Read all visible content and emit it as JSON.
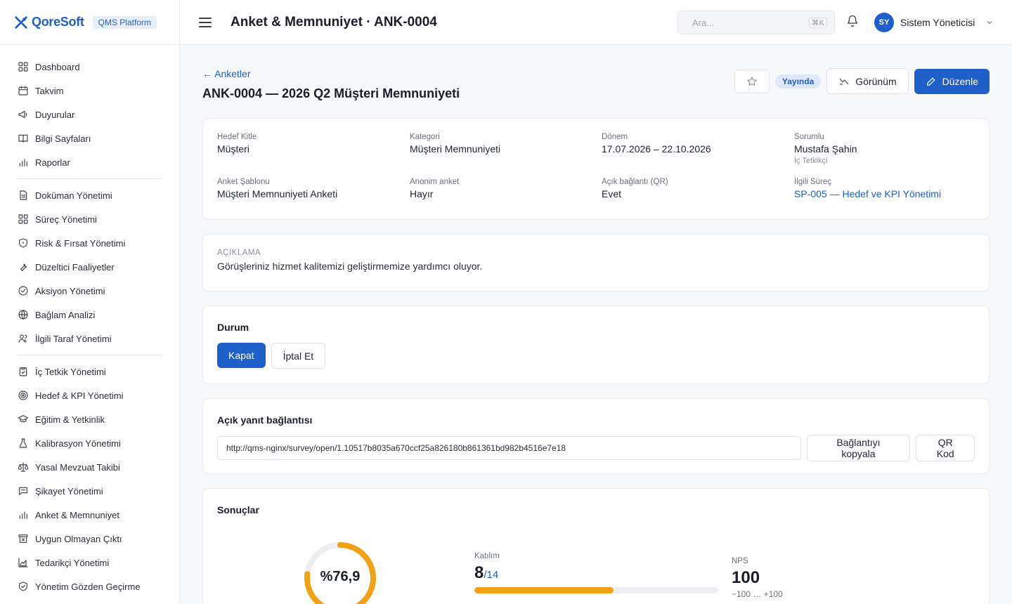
{
  "brand": {
    "name": "QoreSoft",
    "badge": "QMS Platform",
    "accent": "#1f5fc9"
  },
  "sidebar": {
    "groups": [
      [
        {
          "label": "Dashboard",
          "icon": "dashboard-icon"
        },
        {
          "label": "Takvim",
          "icon": "calendar-icon"
        },
        {
          "label": "Duyurular",
          "icon": "megaphone-icon"
        },
        {
          "label": "Bilgi Sayfaları",
          "icon": "book-icon"
        },
        {
          "label": "Raporlar",
          "icon": "bar-chart-icon"
        }
      ],
      [
        {
          "label": "Doküman Yönetimi",
          "icon": "document-icon"
        },
        {
          "label": "Süreç Yönetimi",
          "icon": "grid-icon"
        },
        {
          "label": "Risk & Fırsat Yönetimi",
          "icon": "shield-icon"
        },
        {
          "label": "Düzeltici Faaliyetler",
          "icon": "wrench-icon"
        },
        {
          "label": "Aksiyon Yönetimi",
          "icon": "check-circle-icon"
        },
        {
          "label": "Bağlam Analizi",
          "icon": "globe-icon"
        },
        {
          "label": "İlgili Taraf Yönetimi",
          "icon": "users-icon"
        }
      ],
      [
        {
          "label": "İç Tetkik Yönetimi",
          "icon": "clipboard-check-icon"
        },
        {
          "label": "Hedef & KPI Yönetimi",
          "icon": "target-icon"
        },
        {
          "label": "Eğitim & Yetkinlik",
          "icon": "graduation-cap-icon"
        },
        {
          "label": "Kalibrasyon Yönetimi",
          "icon": "flask-icon"
        },
        {
          "label": "Yasal Mevzuat Takibi",
          "icon": "scale-icon"
        },
        {
          "label": "Şikayet Yönetimi",
          "icon": "message-icon"
        },
        {
          "label": "Anket & Memnuniyet",
          "icon": "bar-chart-icon"
        },
        {
          "label": "Uygun Olmayan Çıktı",
          "icon": "archive-x-icon"
        },
        {
          "label": "Tedarikçi Yönetimi",
          "icon": "area-chart-icon"
        },
        {
          "label": "Yönetim Gözden Geçirme",
          "icon": "shield-check-icon"
        }
      ]
    ]
  },
  "topbar": {
    "heading": "Anket & Memnuniyet · ANK-0004",
    "search_placeholder": "Ara...",
    "search_shortcut": "⌘K",
    "user_initials": "SY",
    "user_name": "Sistem Yöneticisi"
  },
  "page": {
    "back_label": "← Anketler",
    "title": "ANK-0004 — 2026 Q2 Müşteri Memnuniyeti",
    "status": "Yayında",
    "view_button": "Görünüm",
    "edit_button": "Düzenle"
  },
  "info": {
    "hedef_kitle": {
      "label": "Hedef Kitle",
      "value": "Müşteri"
    },
    "kategori": {
      "label": "Kategori",
      "value": "Müşteri Memnuniyeti"
    },
    "donem": {
      "label": "Dönem",
      "value": "17.07.2026 – 22.10.2026"
    },
    "sorumlu": {
      "label": "Sorumlu",
      "value": "Mustafa Şahin",
      "sub": "İç Tetkikçi"
    },
    "sablon": {
      "label": "Anket Şablonu",
      "value": "Müşteri Memnuniyeti Anketi"
    },
    "anonim": {
      "label": "Anonim anket",
      "value": "Hayır"
    },
    "qr": {
      "label": "Açık bağlantı (QR)",
      "value": "Evet"
    },
    "surec": {
      "label": "İlgili Süreç",
      "value": "SP-005 — Hedef ve KPI Yönetimi"
    }
  },
  "description": {
    "label": "AÇIKLAMA",
    "text": "Görüşleriniz hizmet kalitemizi geliştirmemize yardımcı oluyor."
  },
  "status_card": {
    "title": "Durum",
    "close_button": "Kapat",
    "cancel_button": "İptal Et"
  },
  "link_card": {
    "title": "Açık yanıt bağlantısı",
    "url": "http://qms-nginx/survey/open/1.10517b8035a670ccf25a826180b861361bd982b4516e7e18",
    "copy_button": "Bağlantıyı kopyala",
    "qr_button": "QR Kod"
  },
  "results": {
    "title": "Sonuçlar",
    "score_text": "%76,9",
    "score_fraction": 0.769,
    "gauge_color": "#f2a114",
    "participation_label": "Katılım",
    "participation_value": "8",
    "participation_total": "/14",
    "participation_fraction": 0.571,
    "nps_label": "NPS",
    "nps_value": "100",
    "nps_range": "−100 … +100"
  }
}
